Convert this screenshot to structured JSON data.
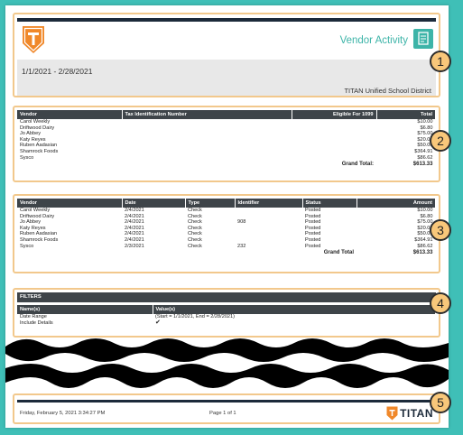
{
  "header": {
    "title": "Vendor Activity",
    "date_range": "1/1/2021 - 2/28/2021",
    "district": "TITAN Unified School District"
  },
  "summary_table": {
    "columns": [
      "Vendor",
      "Tax Identification Number",
      "Eligible For 1099",
      "Total"
    ],
    "rows": [
      [
        "Carol Weekly",
        "",
        "",
        "$10.00"
      ],
      [
        "Driftwood Dairy",
        "",
        "",
        "$6.80"
      ],
      [
        "Jo Abbey",
        "",
        "",
        "$75.00"
      ],
      [
        "Katy Reyes",
        "",
        "",
        "$20.00"
      ],
      [
        "Ruben Aadasian",
        "",
        "",
        "$50.00"
      ],
      [
        "Shamrock Foods",
        "",
        "",
        "$364.91"
      ],
      [
        "Sysco",
        "",
        "",
        "$86.62"
      ]
    ],
    "grand_total_label": "Grand Total:",
    "grand_total_value": "$613.33"
  },
  "detail_table": {
    "columns": [
      "Vendor",
      "Date",
      "Type",
      "Identifier",
      "Status",
      "Amount"
    ],
    "rows": [
      [
        "Carol Weekly",
        "2/4/2021",
        "Check",
        "",
        "Posted",
        "$10.00"
      ],
      [
        "Driftwood Dairy",
        "2/4/2021",
        "Check",
        "",
        "Posted",
        "$6.80"
      ],
      [
        "Jo Abbey",
        "2/4/2021",
        "Check",
        "908",
        "Posted",
        "$75.00"
      ],
      [
        "Katy Reyes",
        "2/4/2021",
        "Check",
        "",
        "Posted",
        "$20.00"
      ],
      [
        "Ruben Aadasian",
        "2/4/2021",
        "Check",
        "",
        "Posted",
        "$50.00"
      ],
      [
        "Shamrock Foods",
        "2/4/2021",
        "Check",
        "",
        "Posted",
        "$364.91"
      ],
      [
        "Sysco",
        "2/3/2021",
        "Check",
        "232",
        "Posted",
        "$86.62"
      ]
    ],
    "grand_total_label": "Grand Total",
    "grand_total_value": "$613.33"
  },
  "filters": {
    "title": "FILTERS",
    "columns": [
      "Name(s)",
      "Value(s)"
    ],
    "rows": [
      [
        "Date Range",
        "(Start = 1/1/2021, End = 2/28/2021)"
      ],
      [
        "Include Details",
        "✔"
      ]
    ]
  },
  "footer": {
    "timestamp": "Friday, February 5, 2021 3:34:27 PM",
    "page": "Page 1 of 1",
    "logo_text": "TITAN"
  },
  "callouts": [
    "1",
    "2",
    "3",
    "4",
    "5"
  ],
  "colors": {
    "background": "#3fbfb7",
    "accent": "#3db4a8",
    "section_border": "#f2c88c",
    "callout_fill": "#f8c77a",
    "logo_orange": "#f0882a",
    "table_header": "#3e4449"
  },
  "icons": {
    "header_logo": "titan-shield-logo",
    "report_icon": "document-icon",
    "footer_logo": "titan-shield-logo"
  }
}
